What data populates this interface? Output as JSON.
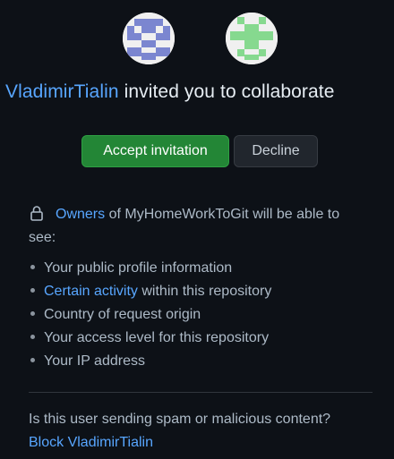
{
  "avatars": {
    "inviter": {
      "color": "#7b86d0"
    },
    "repo_owner": {
      "color": "#86d98f"
    }
  },
  "headline": {
    "username": "VladimirTialin",
    "text": " invited you to collaborate"
  },
  "actions": {
    "accept_label": "Accept invitation",
    "decline_label": "Decline"
  },
  "notice": {
    "owners_link": "Owners",
    "text": " of MyHomeWorkToGit will be able to see:"
  },
  "permissions": [
    {
      "text": "Your public profile information"
    },
    {
      "link": "Certain activity",
      "text": " within this repository"
    },
    {
      "text": "Country of request origin"
    },
    {
      "text": "Your access level for this repository"
    },
    {
      "text": "Your IP address"
    }
  ],
  "spam": {
    "question": "Is this user sending spam or malicious content?",
    "block_label": "Block VladimirTialin"
  },
  "colors": {
    "background": "#0d1117",
    "link": "#58a6ff",
    "accept": "#238636",
    "decline": "#21262d"
  },
  "icons": {
    "lock": "lock-icon",
    "bullet": "bullet-icon"
  }
}
